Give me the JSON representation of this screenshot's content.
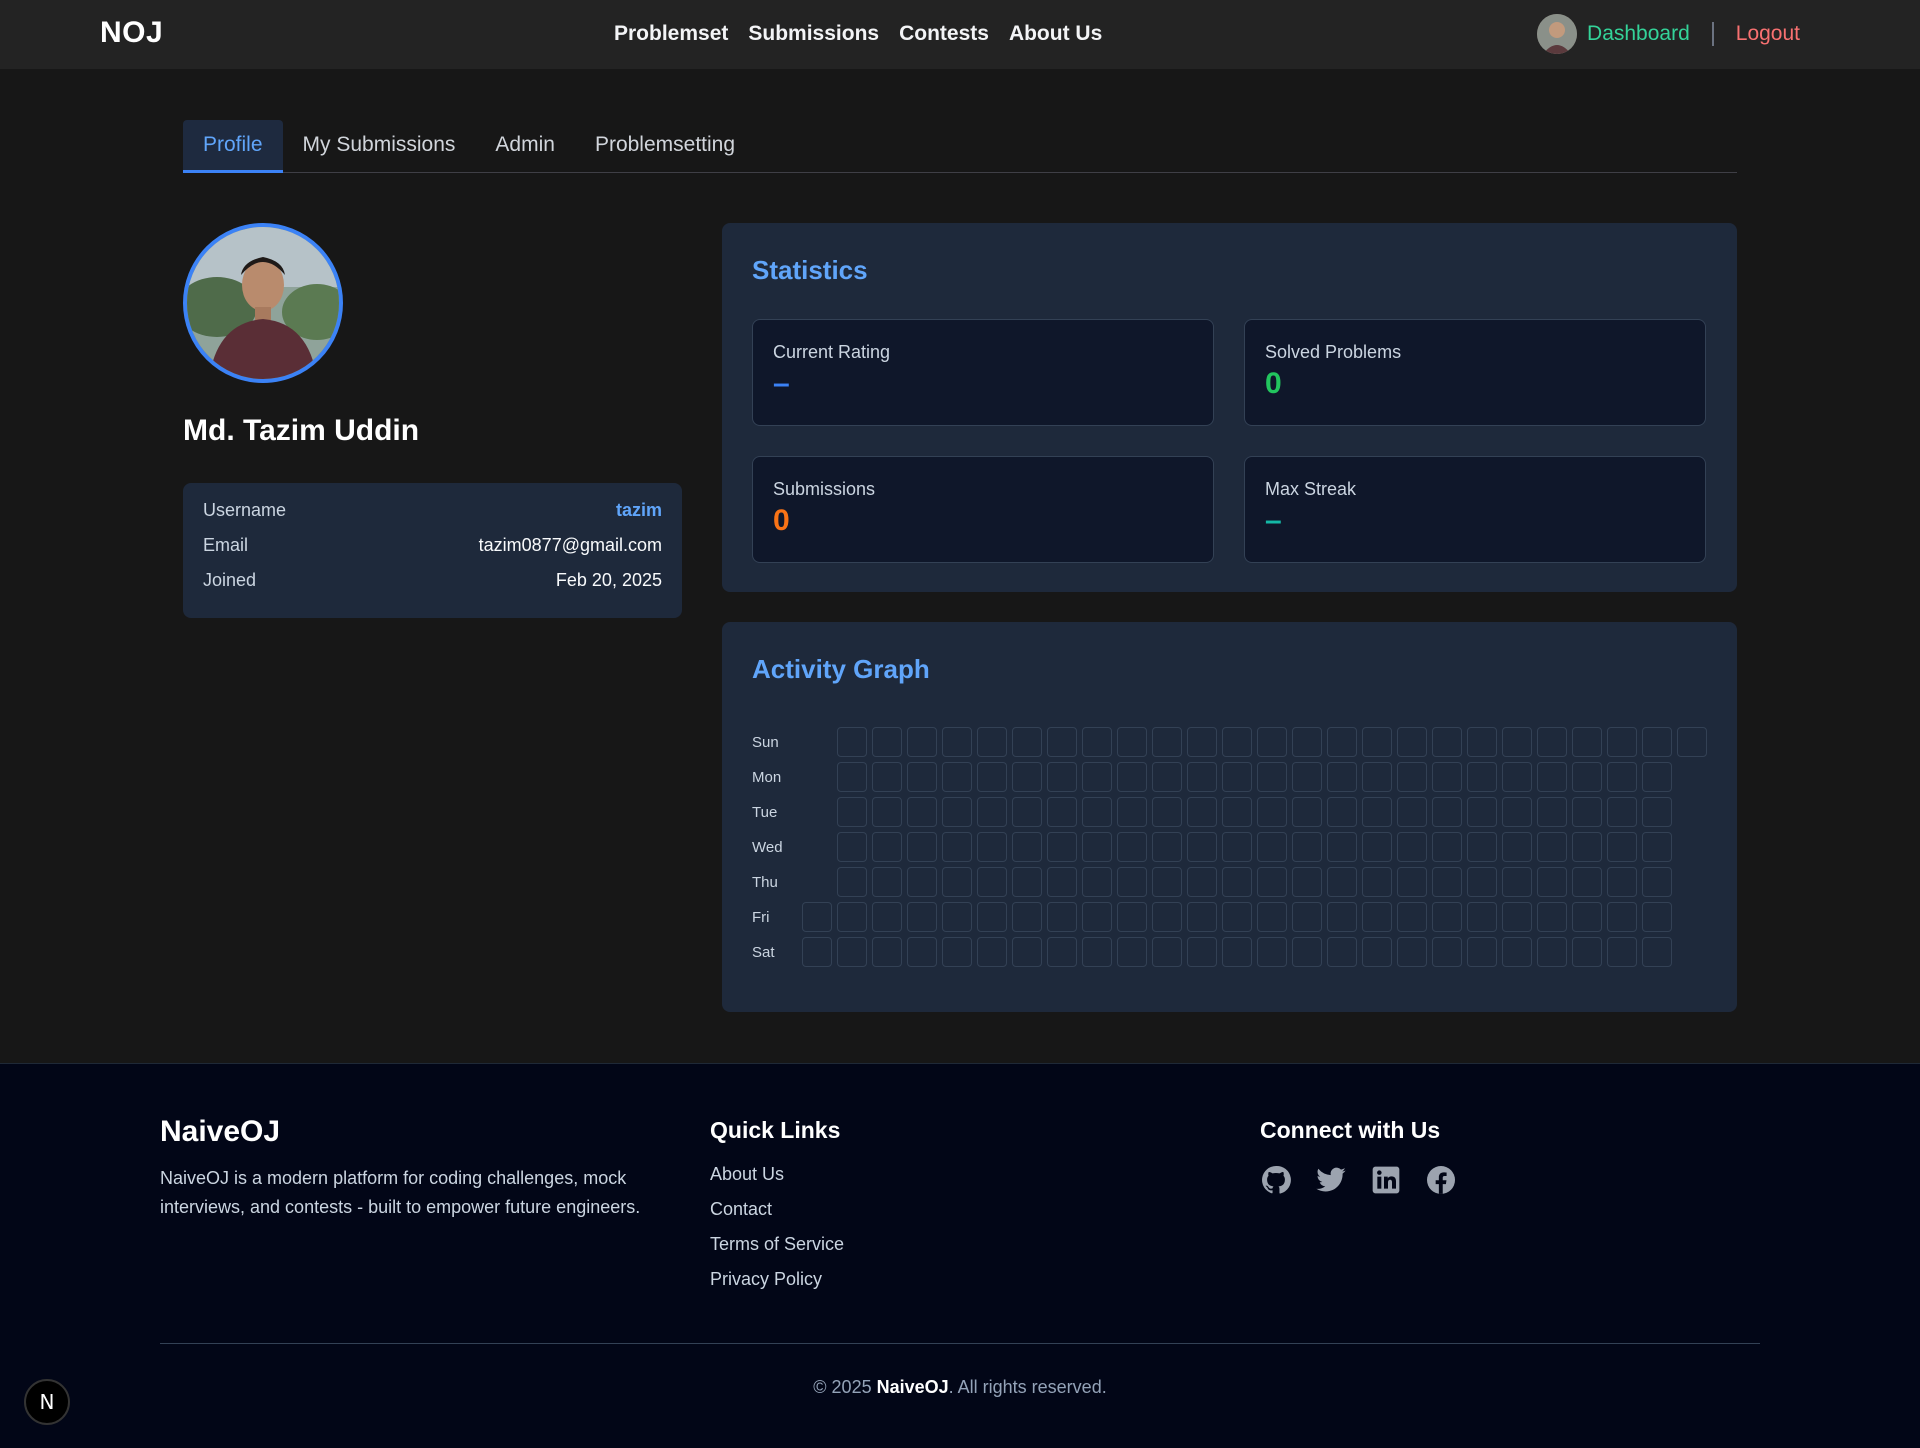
{
  "nav": {
    "brand": "NOJ",
    "links": [
      "Problemset",
      "Submissions",
      "Contests",
      "About Us"
    ],
    "dashboard": "Dashboard",
    "logout": "Logout"
  },
  "tabs": [
    "Profile",
    "My Submissions",
    "Admin",
    "Problemsetting"
  ],
  "profile": {
    "name": "Md. Tazim Uddin",
    "info": [
      {
        "label": "Username",
        "value": "tazim"
      },
      {
        "label": "Email",
        "value": "tazim0877@gmail.com"
      },
      {
        "label": "Joined",
        "value": "Feb 20, 2025"
      }
    ]
  },
  "statistics": {
    "title": "Statistics",
    "cards": [
      {
        "label": "Current Rating",
        "value": "–",
        "color": "#3b82f6"
      },
      {
        "label": "Solved Problems",
        "value": "0",
        "color": "#22c55e"
      },
      {
        "label": "Submissions",
        "value": "0",
        "color": "#f97316"
      },
      {
        "label": "Max Streak",
        "value": "–",
        "color": "#14b8a6"
      }
    ]
  },
  "activity": {
    "title": "Activity Graph",
    "days": [
      "Sun",
      "Mon",
      "Tue",
      "Wed",
      "Thu",
      "Fri",
      "Sat"
    ]
  },
  "footer": {
    "brand": "NaiveOJ",
    "description": "NaiveOJ is a modern platform for coding challenges, mock interviews, and contests - built to empower future engineers.",
    "quick_links_title": "Quick Links",
    "quick_links": [
      "About Us",
      "Contact",
      "Terms of Service",
      "Privacy Policy"
    ],
    "connect_title": "Connect with Us",
    "social_icons": [
      "github-icon",
      "twitter-icon",
      "linkedin-icon",
      "facebook-icon"
    ],
    "copyright_prefix": "© 2025 ",
    "copyright_brand": "NaiveOJ",
    "copyright_suffix": ". All rights reserved."
  },
  "badge": "N"
}
